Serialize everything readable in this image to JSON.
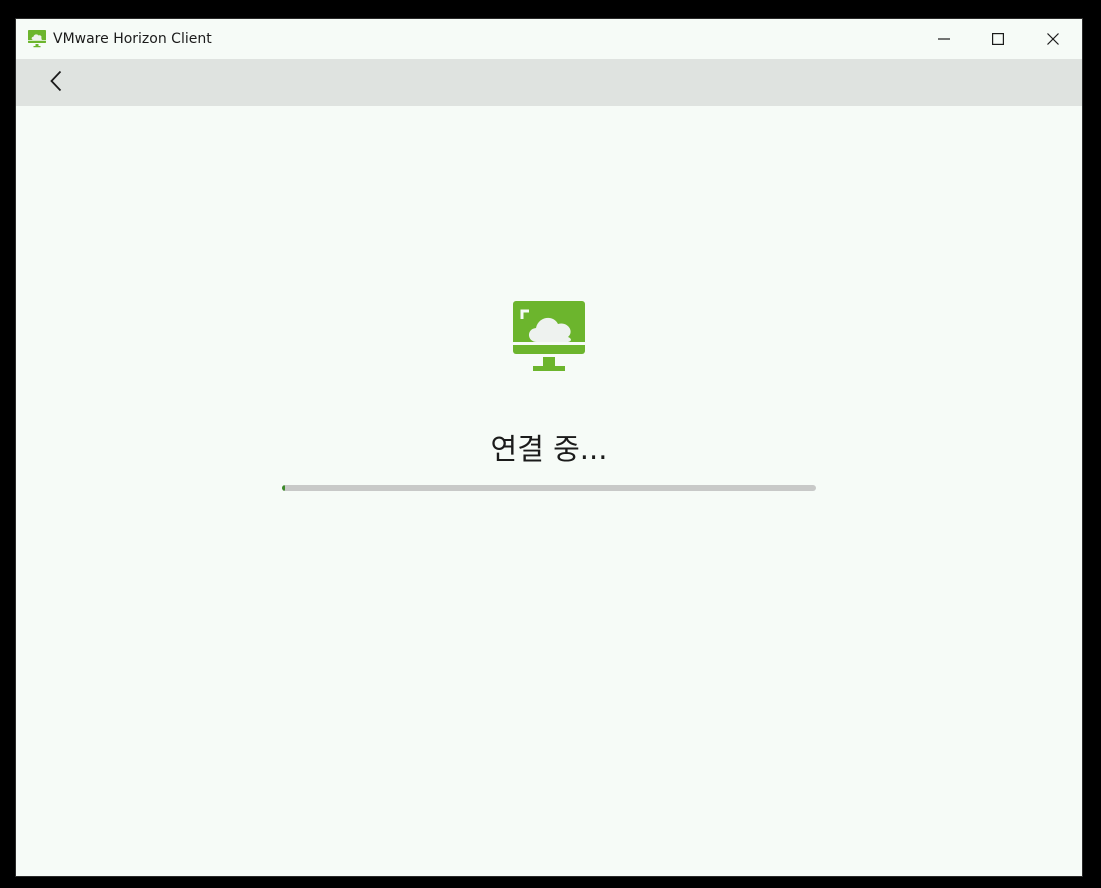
{
  "window": {
    "title": "VMware Horizon Client",
    "app_icon": "horizon-monitor-icon",
    "controls": {
      "minimize_icon": "minimize-icon",
      "maximize_icon": "maximize-icon",
      "close_icon": "close-icon"
    }
  },
  "navbar": {
    "back_icon": "chevron-left-icon"
  },
  "main": {
    "hero_icon": "horizon-monitor-icon",
    "status_text": "연결 중...",
    "progress": {
      "value": 0.005
    }
  },
  "colors": {
    "brand_green": "#6cb52d",
    "progress_fill": "#3d8a2a",
    "progress_track": "#c8c9c8",
    "navbar_bg": "#dfe3e0",
    "window_bg": "#f6fbf7"
  }
}
